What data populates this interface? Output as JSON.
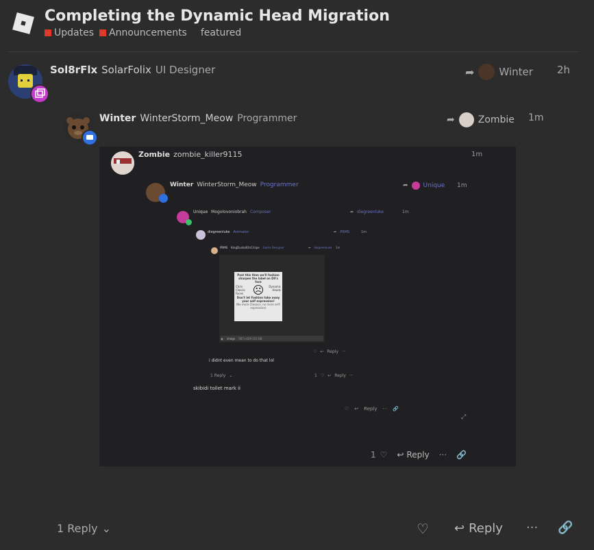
{
  "topic": {
    "title": "Completing the Dynamic Head Migration",
    "categories": [
      {
        "label": "Updates",
        "color": "#e0392b"
      },
      {
        "label": "Announcements",
        "color": "#e0392b"
      }
    ],
    "tag": "featured"
  },
  "post": {
    "username": "Sol8rFlx",
    "display_name": "SolarFolix",
    "title": "UI Designer",
    "reply_to": "Winter",
    "time": "2h",
    "footer": {
      "replies": "1 Reply",
      "reply_label": "Reply"
    }
  },
  "quote": {
    "username": "Winter",
    "display_name": "WinterStorm_Meow",
    "title": "Programmer",
    "reply_to": "Zombie",
    "time": "1m"
  },
  "embedded": {
    "l1": {
      "username": "Zombie",
      "display_name": "zombie_killer9115",
      "time": "1m"
    },
    "l2": {
      "username": "Winter",
      "display_name": "WinterStorm_Meow",
      "title": "Programmer",
      "reply_to": "Unique",
      "time": "1m"
    },
    "l3": {
      "username": "Unique",
      "display_name": "Mogolovoniobrah",
      "title": "Composer",
      "reply_to": "diegreenluke",
      "time": "1m"
    },
    "l4": {
      "username": "diegreenluke",
      "title": "Animator",
      "reply_to": "PRMS",
      "time": "1m"
    },
    "l5": {
      "username": "PRMS",
      "display_name": "KingDustedOnCrispe",
      "title": "Game Designer",
      "reply_to": "diegreenluke",
      "time": "1m"
    },
    "card": {
      "top": "Post this then we'll fashion sharpen the label on Dll's face",
      "left": "Chris Classic Faces",
      "right": "Dynamic Heads",
      "bottom": "Don't let Fashion take away your self expression!",
      "smallprint": "(No more Classics, no more self-expression)"
    },
    "image_label": "image",
    "image_size": "587×429 315 KB",
    "l4_text": "i didnt even mean to do that lol",
    "l4_replies": "1 Reply",
    "l4_likes": "1",
    "l3_text": "skibidi toilet mark ii",
    "reply_label": "Reply",
    "l1_likes": "1"
  }
}
